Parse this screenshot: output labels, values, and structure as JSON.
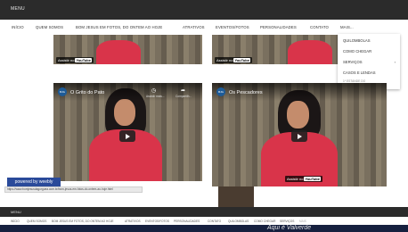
{
  "header": {
    "menu_label": "MENU"
  },
  "nav": {
    "items": [
      "INÍCIO",
      "QUEM SOMOS",
      "BOM JESUS EM FOTOS, DO ONTEM AO HOJE",
      "ATRATIVOS",
      "EVENTOS/FOTOS",
      "PERSONALIDADES",
      "CONTATO",
      "MAIS..."
    ]
  },
  "dropdown": {
    "items": [
      "QUILOMBOLAS",
      "COMO CHEGAR",
      "SERVIÇOS",
      "CASOS E LENDAS",
      "1º ESTANDE DO ARTESANATO CULTURAL"
    ],
    "submenu_arrow": "›"
  },
  "videos": {
    "watch_on": "Assistir no",
    "youtube": "YouTube",
    "left": {
      "title": "O Grito do Pato",
      "watch_later": "Assistir mais...",
      "share": "Compartilh...",
      "channel_short": "BJG"
    },
    "right": {
      "title": "Os Pescadores",
      "channel_short": "BJG"
    }
  },
  "badge": {
    "text": "powered by weebly"
  },
  "status_url": "https://www.bomjesusdagurguea.com.br/bom-jesus-em-fotos-do-ontem-ao-hoje.html",
  "footer": {
    "menu_label": "MENU",
    "items": [
      "INÍCIO",
      "QUEM SOMOS",
      "BOM JESUS EM FOTOS, DO ONTEM AO HOJE",
      "ATRATIVOS",
      "EVENTOS/FOTOS",
      "PERSONALIDADES",
      "CONTATO",
      "QUILOMBOLAS",
      "COMO CHEGAR",
      "SERVIÇOS",
      "MAIS"
    ]
  },
  "caption": {
    "text": "Aqui é Valverde"
  }
}
